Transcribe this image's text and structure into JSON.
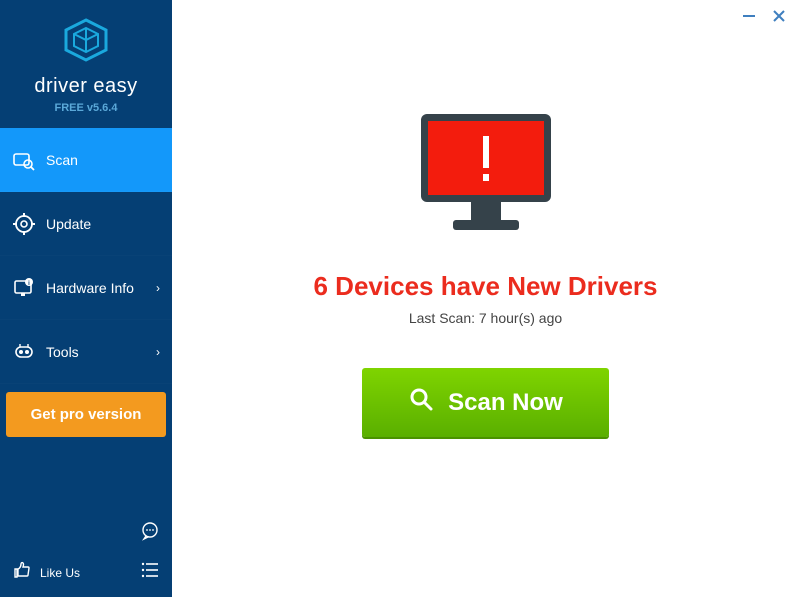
{
  "brand": {
    "name": "driver easy",
    "version": "FREE v5.6.4"
  },
  "nav": {
    "scan": "Scan",
    "update": "Update",
    "hardware": "Hardware Info",
    "tools": "Tools"
  },
  "pro_button": "Get pro version",
  "likeus": "Like Us",
  "main": {
    "headline": "6 Devices have New Drivers",
    "lastscan": "Last Scan: 7 hour(s) ago",
    "scan_button": "Scan Now"
  },
  "colors": {
    "sidebar": "#053f74",
    "active": "#1398fa",
    "pro": "#f39a1f",
    "alert": "#eb2c1e",
    "scan_green": "#6cc400"
  }
}
